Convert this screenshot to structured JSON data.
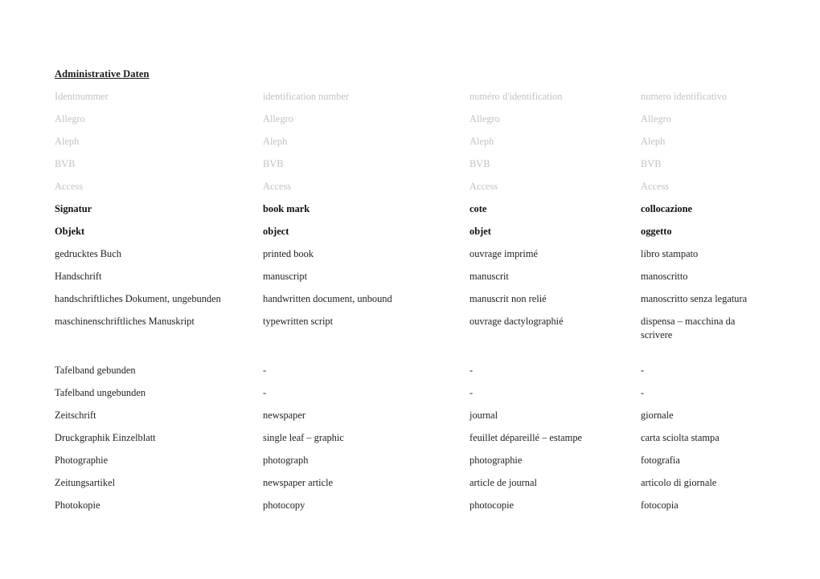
{
  "document": {
    "title": "Administrative Daten",
    "columns": [
      "german",
      "english",
      "french",
      "italian"
    ],
    "rows": [
      {
        "style": "muted",
        "cells": [
          "Identnummer",
          "identification number",
          "numéro d'identification",
          "numero identificativo"
        ]
      },
      {
        "style": "muted",
        "cells": [
          "Allegro",
          "Allegro",
          "Allegro",
          "Allegro"
        ]
      },
      {
        "style": "muted",
        "cells": [
          "Aleph",
          "Aleph",
          "Aleph",
          "Aleph"
        ]
      },
      {
        "style": "muted",
        "cells": [
          "BVB",
          "BVB",
          "BVB",
          "BVB"
        ]
      },
      {
        "style": "muted",
        "cells": [
          "Access",
          "Access",
          "Access",
          "Access"
        ]
      },
      {
        "style": "strong",
        "cells": [
          "Signatur",
          "book mark",
          "cote",
          "collocazione"
        ]
      },
      {
        "style": "strong",
        "cells": [
          "Objekt",
          "object",
          "objet",
          "oggetto"
        ]
      },
      {
        "style": "normal",
        "cells": [
          "gedrucktes Buch",
          "printed book",
          "ouvrage imprimé",
          "libro stampato"
        ]
      },
      {
        "style": "normal",
        "cells": [
          "Handschrift",
          "manuscript",
          "manuscrit",
          "manoscritto"
        ]
      },
      {
        "style": "normal",
        "cells": [
          "handschriftliches Dokument, ungebunden",
          "handwritten document, unbound",
          "manuscrit non relié",
          "manoscritto senza legatura"
        ]
      },
      {
        "style": "normal",
        "cells": [
          "maschinenschriftliches Manuskript",
          "typewritten script",
          "ouvrage dactylographié",
          "dispensa – macchina da scrivere"
        ]
      },
      {
        "style": "spacer",
        "cells": [
          "",
          "",
          "",
          ""
        ]
      },
      {
        "style": "normal",
        "cells": [
          "Tafelband gebunden",
          "-",
          "-",
          "-"
        ]
      },
      {
        "style": "normal",
        "cells": [
          "Tafelband ungebunden",
          "-",
          "-",
          "-"
        ]
      },
      {
        "style": "normal",
        "cells": [
          "Zeitschrift",
          "newspaper",
          "journal",
          "giornale"
        ]
      },
      {
        "style": "normal",
        "cells": [
          "Druckgraphik Einzelblatt",
          "single leaf – graphic",
          "feuillet dépareillé – estampe",
          "carta sciolta stampa"
        ]
      },
      {
        "style": "normal",
        "cells": [
          "Photographie",
          "photograph",
          "photographie",
          "fotografia"
        ]
      },
      {
        "style": "normal",
        "cells": [
          "Zeitungsartikel",
          "newspaper article",
          "article de journal",
          "articolo di giornale"
        ]
      },
      {
        "style": "normal",
        "cells": [
          "Photokopie",
          "photocopy",
          "photocopie",
          "fotocopia"
        ]
      }
    ]
  },
  "colors": {
    "page_background": "#ffffff",
    "text": "#222222",
    "muted_text": "#c2c2c2",
    "heading": "#111111"
  }
}
